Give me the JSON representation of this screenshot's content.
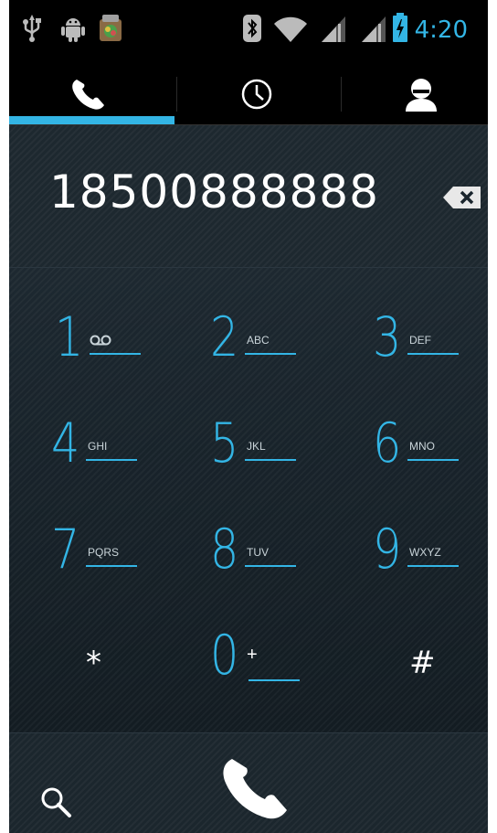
{
  "status_bar": {
    "time": "4:20",
    "left_icons": [
      "usb-icon",
      "android-debug-icon",
      "app-notification-icon"
    ],
    "right_icons": [
      "bluetooth-icon",
      "wifi-icon",
      "signal-icon",
      "signal-icon",
      "battery-charging-icon"
    ]
  },
  "tabs": [
    {
      "name": "phone",
      "icon": "phone-icon",
      "selected": true
    },
    {
      "name": "call-log",
      "icon": "clock-icon",
      "selected": false
    },
    {
      "name": "contacts",
      "icon": "person-icon",
      "selected": false
    }
  ],
  "dialer": {
    "number": "18500888888",
    "backspace_icon": "backspace-icon"
  },
  "keypad": [
    {
      "digit": "1",
      "letters": "ꝏ",
      "icon": "voicemail-icon"
    },
    {
      "digit": "2",
      "letters": "ABC"
    },
    {
      "digit": "3",
      "letters": "DEF"
    },
    {
      "digit": "4",
      "letters": "GHI"
    },
    {
      "digit": "5",
      "letters": "JKL"
    },
    {
      "digit": "6",
      "letters": "MNO"
    },
    {
      "digit": "7",
      "letters": "PQRS"
    },
    {
      "digit": "8",
      "letters": "TUV"
    },
    {
      "digit": "9",
      "letters": "WXYZ"
    },
    {
      "digit": "*",
      "letters": ""
    },
    {
      "digit": "0",
      "letters": "+"
    },
    {
      "digit": "#",
      "letters": ""
    }
  ],
  "bottom_bar": {
    "search_icon": "search-icon",
    "call_icon": "call-icon"
  },
  "colors": {
    "accent": "#33b5e5",
    "background": "#1a252d",
    "text": "#ffffff"
  }
}
